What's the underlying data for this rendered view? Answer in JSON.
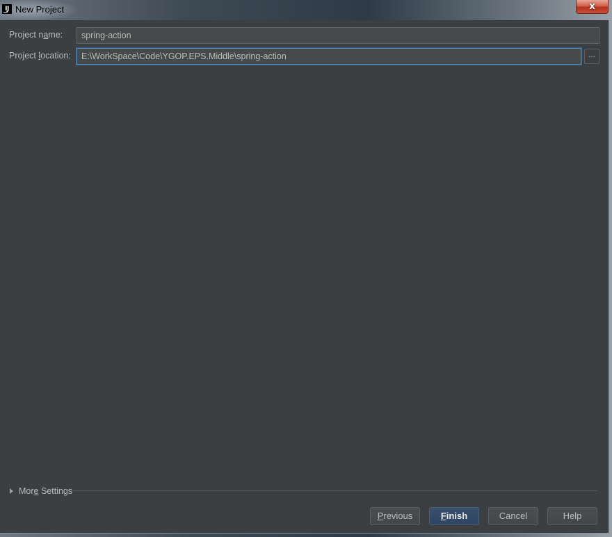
{
  "window": {
    "title": "New Project",
    "app_icon": "intellij-idea-icon",
    "close_glyph": "x"
  },
  "form": {
    "project_name": {
      "label_pre": "Project n",
      "label_mnemonic": "a",
      "label_post": "me:",
      "value": "spring-action"
    },
    "project_location": {
      "label_pre": "Project ",
      "label_mnemonic": "l",
      "label_post": "ocation:",
      "value": "E:\\WorkSpace\\Code\\YGOP.EPS.Middle\\spring-action",
      "browse_label": "..."
    }
  },
  "more_settings": {
    "label_pre": "Mor",
    "label_mnemonic": "e",
    "label_post": " Settings",
    "expanded": false
  },
  "buttons": {
    "previous": {
      "mnemonic": "P",
      "rest": "revious"
    },
    "finish": {
      "mnemonic": "F",
      "rest": "inish"
    },
    "cancel": {
      "label": "Cancel"
    },
    "help": {
      "label": "Help"
    }
  }
}
